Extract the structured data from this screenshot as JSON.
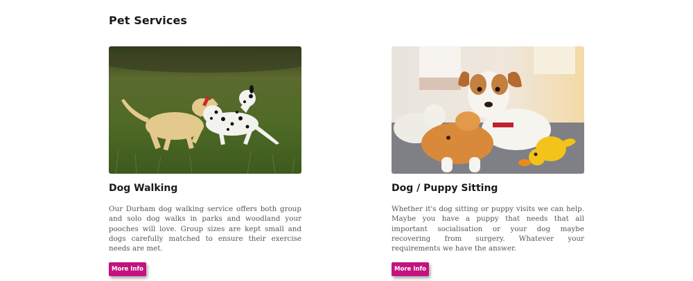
{
  "section": {
    "title": "Pet Services"
  },
  "cards": [
    {
      "image_alt": "Dog walking photo",
      "title": "Dog Walking",
      "text": "Our Durham dog walking service offers both group and solo dog walks in parks and woodland your pooches will love. Group sizes are kept small and dogs carefully matched to ensure their exercise needs are met.",
      "button_label": "More Info"
    },
    {
      "image_alt": "Puppy sitting photo",
      "title": "Dog / Puppy Sitting",
      "text": "Whether it's dog sitting or puppy visits we can help. Maybe you have a puppy that needs that all important socialisation or your dog maybe recovering from surgery. Whatever your requirements we have the answer.",
      "button_label": "More Info"
    }
  ],
  "colors": {
    "accent": "#c4127e",
    "heading": "#1a1a1a",
    "body_text": "#555555"
  }
}
